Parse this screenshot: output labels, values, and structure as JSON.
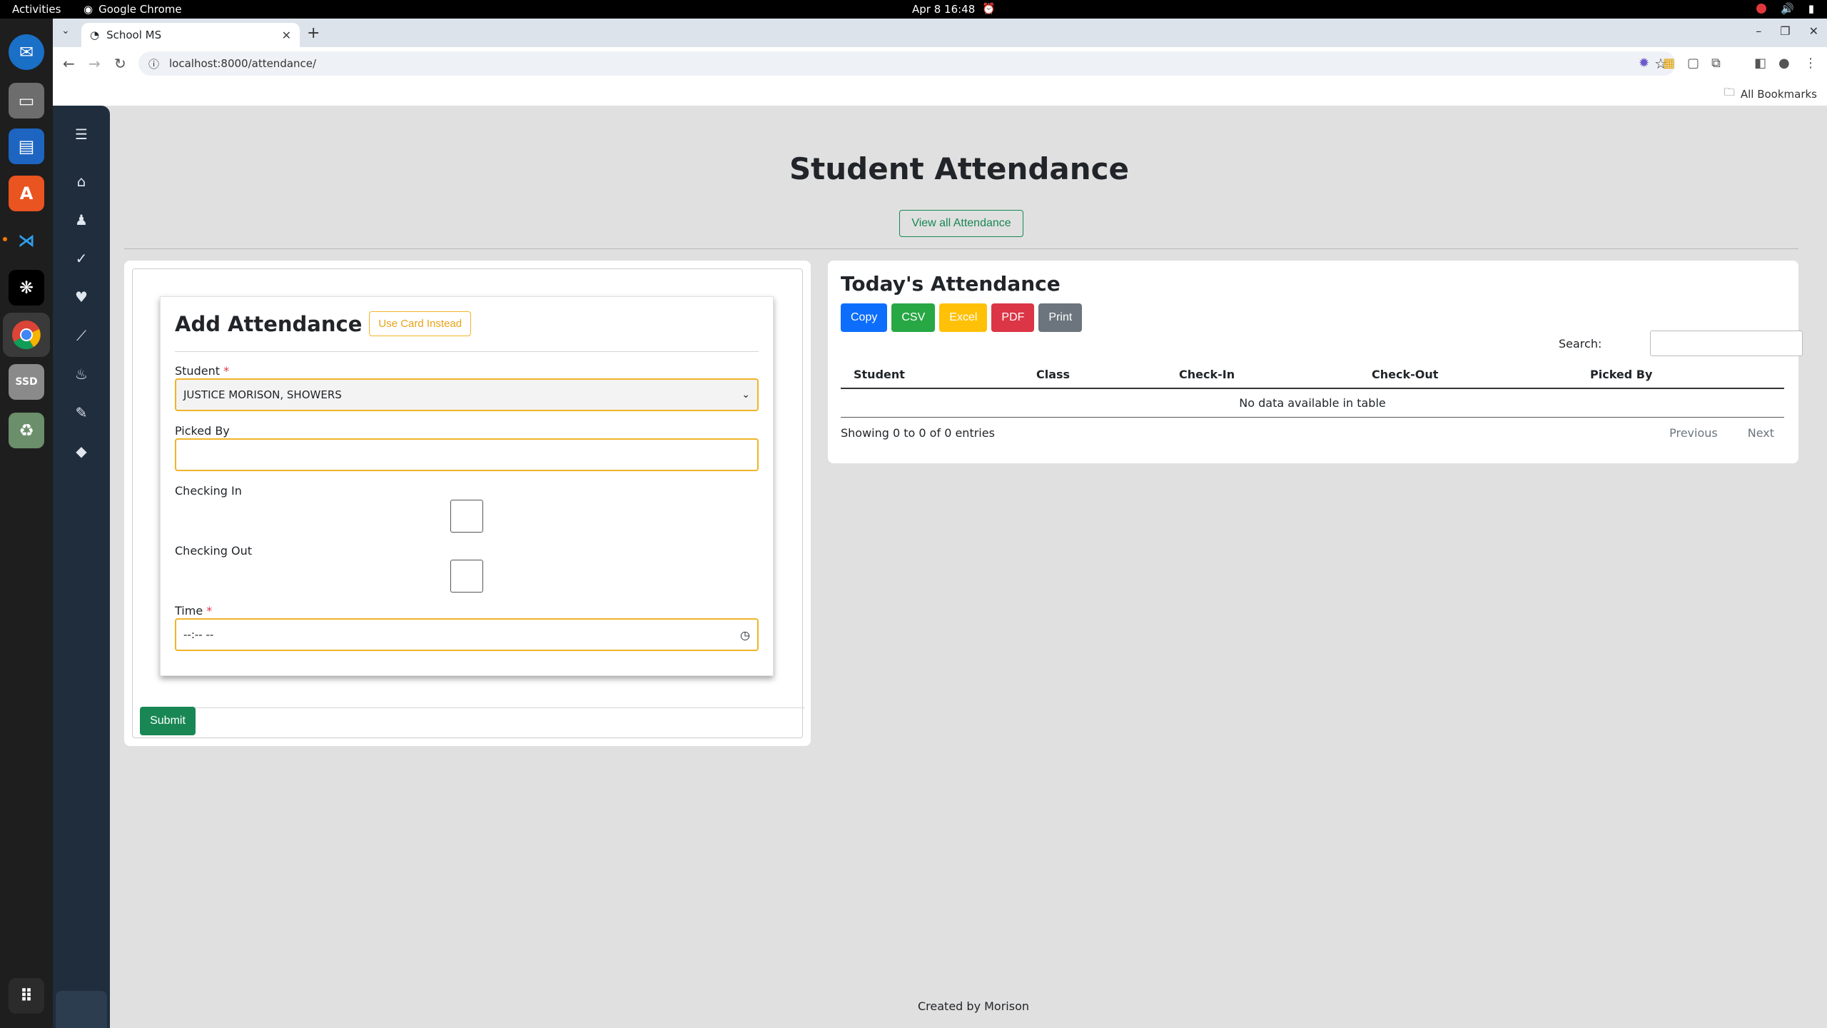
{
  "system_bar": {
    "activities": "Activities",
    "app_name": "Google Chrome",
    "clock": "Apr 8  16:48"
  },
  "browser": {
    "tab_title": "School MS",
    "url": "localhost:8000/attendance/",
    "bookmarks_label": "All Bookmarks"
  },
  "page": {
    "title": "Student Attendance",
    "view_all_label": "View all Attendance",
    "footer": "Created by Morison"
  },
  "form": {
    "title": "Add Attendance",
    "use_card_label": "Use Card Instead",
    "student_label": "Student",
    "required_mark": "*",
    "student_value": "JUSTICE MORISON, SHOWERS",
    "picked_by_label": "Picked By",
    "picked_by_value": "",
    "checking_in_label": "Checking In",
    "checking_in_checked": false,
    "checking_out_label": "Checking Out",
    "checking_out_checked": false,
    "time_label": "Time",
    "time_value": "--:-- --",
    "submit_label": "Submit"
  },
  "today": {
    "title": "Today's Attendance",
    "buttons": [
      {
        "label": "Copy",
        "color": "#0d6efd"
      },
      {
        "label": "CSV",
        "color": "#28a745"
      },
      {
        "label": "Excel",
        "color": "#ffc107"
      },
      {
        "label": "PDF",
        "color": "#dc3545"
      },
      {
        "label": "Print",
        "color": "#6c757d"
      }
    ],
    "search_label": "Search:",
    "columns": [
      "Student",
      "Class",
      "Check-In",
      "Check-Out",
      "Picked By"
    ],
    "empty_message": "No data available in table",
    "info": "Showing 0 to 0 of 0 entries",
    "prev_label": "Previous",
    "next_label": "Next"
  },
  "colors": {
    "accent_green": "#198754",
    "warning_yellow": "#f0b429",
    "sidenav_bg": "#1f2d3d"
  },
  "icons": {
    "sidenav": [
      "menu-icon",
      "home-icon",
      "user-graduate-icon",
      "check-icon",
      "heart-icon",
      "chart-line-icon",
      "fire-icon",
      "pencil-icon",
      "gem-icon"
    ]
  }
}
